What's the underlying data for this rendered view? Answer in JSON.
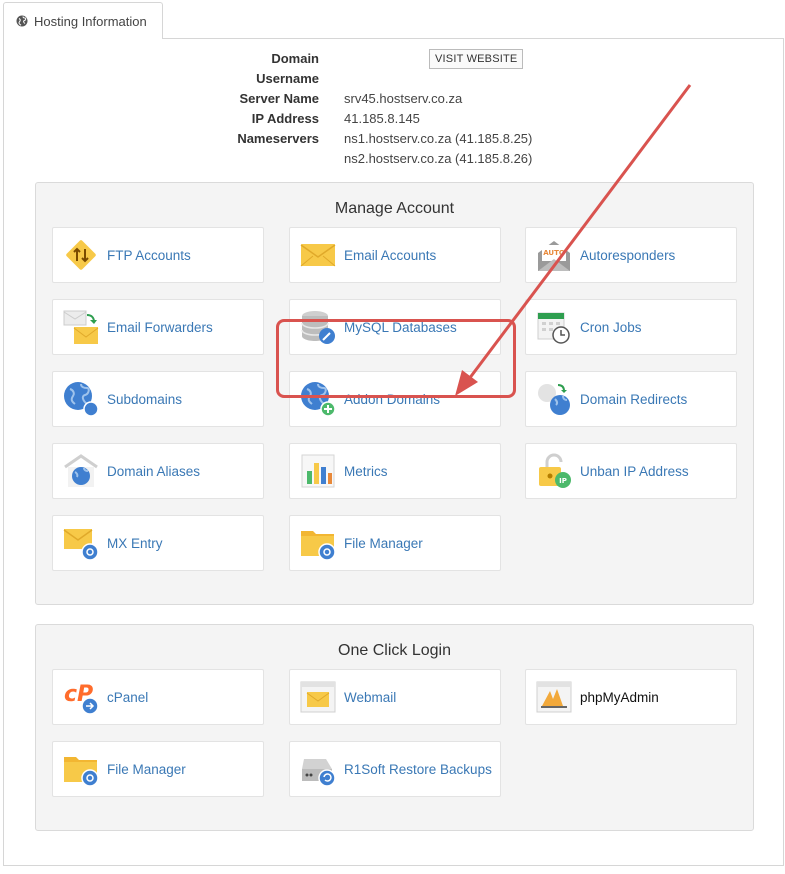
{
  "tab": {
    "label": "Hosting Information",
    "icon": "globe-icon"
  },
  "info": {
    "domain_label": "Domain",
    "username_label": "Username",
    "server_label": "Server Name",
    "server_value": "srv45.hostserv.co.za",
    "ip_label": "IP Address",
    "ip_value": "41.185.8.145",
    "ns_label": "Nameservers",
    "ns1": "ns1.hostserv.co.za (41.185.8.25)",
    "ns2": "ns2.hostserv.co.za (41.185.8.26)",
    "visit_button": "VISIT WEBSITE"
  },
  "manage": {
    "title": "Manage Account",
    "items": [
      {
        "label": "FTP Accounts",
        "icon": "ftp-icon"
      },
      {
        "label": "Email Accounts",
        "icon": "envelope-icon"
      },
      {
        "label": "Autoresponders",
        "icon": "autoresponder-icon",
        "badge": "AUTO"
      },
      {
        "label": "Email Forwarders",
        "icon": "email-forwarder-icon"
      },
      {
        "label": "MySQL Databases",
        "icon": "database-icon"
      },
      {
        "label": "Cron Jobs",
        "icon": "calendar-clock-icon"
      },
      {
        "label": "Subdomains",
        "icon": "globe-icon"
      },
      {
        "label": "Addon Domains",
        "icon": "globe-plus-icon"
      },
      {
        "label": "Domain Redirects",
        "icon": "redirect-icon"
      },
      {
        "label": "Domain Aliases",
        "icon": "domain-alias-icon"
      },
      {
        "label": "Metrics",
        "icon": "bar-chart-icon"
      },
      {
        "label": "Unban IP Address",
        "icon": "unlock-ip-icon",
        "badge": "IP"
      },
      {
        "label": "MX Entry",
        "icon": "mx-envelope-gear-icon"
      },
      {
        "label": "File Manager",
        "icon": "folder-gear-icon"
      }
    ]
  },
  "login": {
    "title": "One Click Login",
    "items": [
      {
        "label": "cPanel",
        "icon": "cpanel-icon"
      },
      {
        "label": "Webmail",
        "icon": "webmail-icon"
      },
      {
        "label": "phpMyAdmin",
        "icon": "phpmyadmin-icon"
      },
      {
        "label": "File Manager",
        "icon": "folder-gear-icon"
      },
      {
        "label": "R1Soft Restore Backups",
        "icon": "backup-restore-icon"
      }
    ]
  },
  "colors": {
    "link": "#3a78b5",
    "highlight": "#d9534f",
    "section_bg": "#f4f4f4",
    "icon_yellow": "#f7c948",
    "icon_blue": "#3f7fd0"
  }
}
